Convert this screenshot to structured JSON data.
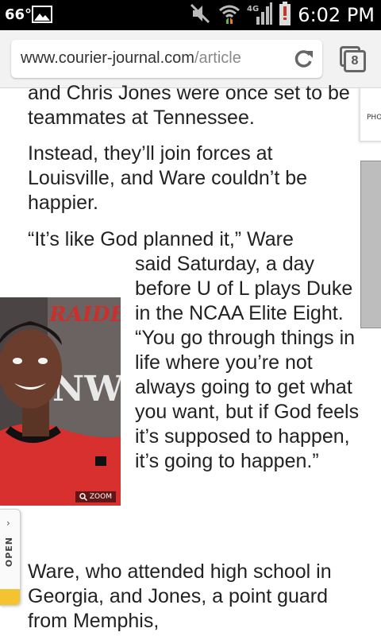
{
  "status_bar": {
    "temperature": "66°",
    "time": "6:02 PM",
    "battery_percent": "3%"
  },
  "browser": {
    "url_domain": "www.courier-journal.com",
    "url_path": "/article",
    "tab_count": "8"
  },
  "article": {
    "paragraph_1": "and Chris Jones were once set to be teammates at Tennessee.",
    "paragraph_2": "Instead, they’ll join forces at Louisville, and Ware couldn’t be happier.",
    "paragraph_3_start": "“It’s like God planned it,” Ware",
    "paragraph_3_wrap": "said Saturday, a day before U of L plays Duke in the NCAA Elite Eight. “You go through things in life where you’re not always going to get what you want, but if God feels it’s supposed to happen, it’s going to happen.”",
    "paragraph_4": "Ware, who attended high school in Georgia, and Jones, a point guard from Memphis,"
  },
  "photo": {
    "zoom_label": "ZOOM",
    "jersey_text": "RAIDE",
    "backdrop_text": "NWF"
  },
  "side_ad": {
    "label": "PHO"
  },
  "open_tab": {
    "label": "OPEN",
    "chevron": "›"
  },
  "colors": {
    "status_bar_bg": "#000000",
    "toolbar_bg": "#f2f2f2",
    "jersey_red": "#d8302f",
    "open_tab_accent": "#f4c430"
  }
}
